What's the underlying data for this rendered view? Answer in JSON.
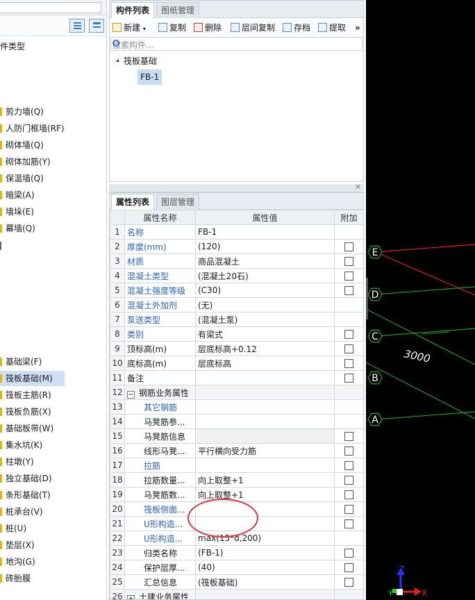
{
  "left_panel": {
    "section_label": "件类型",
    "items_top": [
      {
        "label": "剪力墙(Q)"
      },
      {
        "label": "人防门框墙(RF)"
      },
      {
        "label": "砌体墙(Q)"
      },
      {
        "label": "砌体加筋(Y)"
      },
      {
        "label": "保温墙(Q)"
      },
      {
        "label": "暗梁(A)"
      },
      {
        "label": "墙垛(E)"
      },
      {
        "label": "幕墙(Q)"
      }
    ],
    "items_bottom": [
      {
        "label": "基础梁(F)"
      },
      {
        "label": "筏板基础(M)",
        "selected": true
      },
      {
        "label": "筏板主筋(R)"
      },
      {
        "label": "筏板负筋(X)"
      },
      {
        "label": "基础板带(W)"
      },
      {
        "label": "集水坑(K)"
      },
      {
        "label": "柱墩(Y)"
      },
      {
        "label": "独立基础(D)"
      },
      {
        "label": "条形基础(T)"
      },
      {
        "label": "桩承台(V)"
      },
      {
        "label": "桩(U)"
      },
      {
        "label": "垫层(X)"
      },
      {
        "label": "地沟(G)"
      },
      {
        "label": "砖胎膜"
      }
    ]
  },
  "component_panel": {
    "tabs": [
      "构件列表",
      "图纸管理"
    ],
    "toolbar": {
      "new": "新建",
      "copy": "复制",
      "delete": "删除",
      "floor_copy": "层间复制",
      "save": "存档",
      "extract": "提取",
      "more": "»"
    },
    "search_placeholder": "搜索构件...",
    "tree_root": "筏板基础",
    "tree_leaf": "FB-1"
  },
  "property_panel": {
    "tabs": [
      "属性列表",
      "图层管理"
    ],
    "columns": [
      "属性名称",
      "属性值",
      "附加"
    ],
    "rows": [
      {
        "n": "1",
        "name": "名称",
        "value": "FB-1",
        "style": "blue",
        "check": false
      },
      {
        "n": "2",
        "name": "厚度(mm)",
        "value": "(120)",
        "style": "blue",
        "check": true
      },
      {
        "n": "3",
        "name": "材质",
        "value": "商品混凝土",
        "style": "blue",
        "check": true
      },
      {
        "n": "4",
        "name": "混凝土类型",
        "value": "(混凝土20石)",
        "style": "blue",
        "check": true
      },
      {
        "n": "5",
        "name": "混凝土强度等级",
        "value": "(C30)",
        "style": "blue",
        "check": true
      },
      {
        "n": "6",
        "name": "混凝土外加剂",
        "value": "(无)",
        "style": "blue",
        "check": false
      },
      {
        "n": "7",
        "name": "泵送类型",
        "value": "(混凝土泵)",
        "style": "blue",
        "check": false
      },
      {
        "n": "8",
        "name": "类别",
        "value": "有梁式",
        "style": "blue",
        "check": true
      },
      {
        "n": "9",
        "name": "顶标高(m)",
        "value": "层底标高+0.12",
        "style": "black",
        "check": true
      },
      {
        "n": "10",
        "name": "底标高(m)",
        "value": "层底标高",
        "style": "black",
        "check": true
      },
      {
        "n": "11",
        "name": "备注",
        "value": "",
        "style": "black",
        "check": true
      },
      {
        "n": "12",
        "name": "钢筋业务属性",
        "value": "",
        "style": "group",
        "check": false
      },
      {
        "n": "13",
        "name": "其它钢筋",
        "value": "",
        "style": "indent-blue",
        "check": false
      },
      {
        "n": "14",
        "name": "马凳筋参...",
        "value": "",
        "style": "indent",
        "check": false
      },
      {
        "n": "15",
        "name": "马凳筋信息",
        "value": "",
        "style": "indent",
        "check": true,
        "gray": true
      },
      {
        "n": "16",
        "name": "线形马凳...",
        "value": "平行横向受力筋",
        "style": "indent",
        "check": true
      },
      {
        "n": "17",
        "name": "拉筋",
        "value": "",
        "style": "indent-blue",
        "check": true
      },
      {
        "n": "18",
        "name": "拉筋数量...",
        "value": "向上取整+1",
        "style": "indent",
        "check": true
      },
      {
        "n": "19",
        "name": "马凳筋数...",
        "value": "向上取整+1",
        "style": "indent",
        "check": true
      },
      {
        "n": "20",
        "name": "筏板侧面...",
        "value": "",
        "style": "indent-blue",
        "check": true
      },
      {
        "n": "21",
        "name": "U形构造...",
        "value": "",
        "style": "indent-blue",
        "check": true
      },
      {
        "n": "22",
        "name": "U形构造...",
        "value": "max(15*d,200)",
        "style": "indent-blue",
        "check": false
      },
      {
        "n": "23",
        "name": "归类名称",
        "value": "(FB-1)",
        "style": "indent",
        "check": true
      },
      {
        "n": "24",
        "name": "保护层厚...",
        "value": "(40)",
        "style": "indent",
        "check": true
      },
      {
        "n": "25",
        "name": "汇总信息",
        "value": "(筏板基础)",
        "style": "indent",
        "check": true
      },
      {
        "n": "26",
        "name": "土建业务属性",
        "value": "",
        "style": "group",
        "check": false
      }
    ]
  },
  "canvas": {
    "axis_labels": [
      "E",
      "D",
      "C",
      "B",
      "A"
    ],
    "dimension": "3000",
    "ucs_x": "X",
    "ucs_y": "Y",
    "ucs_z": "Z",
    "colors": {
      "grid_line": "#1f9a1f",
      "red_line": "#e02020",
      "background": "#000000"
    }
  }
}
